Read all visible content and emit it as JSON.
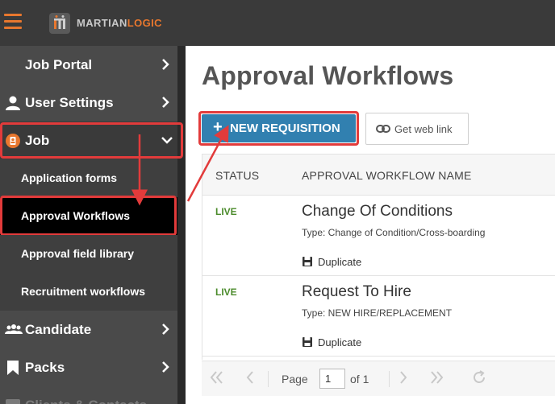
{
  "header": {
    "logo_part1": "MARTIAN",
    "logo_part2": "LOGIC",
    "brand_color": "#e8772e"
  },
  "sidebar": {
    "items": [
      {
        "label": "Job Portal",
        "icon": "none"
      },
      {
        "label": "User Settings",
        "icon": "user-icon"
      },
      {
        "label": "Job",
        "icon": "job-icon",
        "expanded": true
      },
      {
        "label": "Candidate",
        "icon": "users-icon"
      },
      {
        "label": "Packs",
        "icon": "bookmark-icon"
      },
      {
        "label": "Clients & Contacts",
        "icon": "contacts-icon"
      }
    ],
    "job_subitems": [
      {
        "label": "Application forms"
      },
      {
        "label": "Approval Workflows",
        "active": true
      },
      {
        "label": "Approval field library"
      },
      {
        "label": "Recruitment workflows"
      }
    ]
  },
  "main": {
    "title": "Approval Workflows",
    "new_button": "NEW REQUISITION",
    "new_button_icon": "+",
    "web_link_button": "Get web link",
    "table": {
      "headers": [
        "STATUS",
        "APPROVAL WORKFLOW NAME"
      ],
      "rows": [
        {
          "status": "LIVE",
          "name": "Change Of Conditions",
          "type": "Type: Change of Condition/Cross-boarding",
          "action": "Duplicate"
        },
        {
          "status": "LIVE",
          "name": "Request To Hire",
          "type": "Type: NEW HIRE/REPLACEMENT",
          "action": "Duplicate"
        }
      ]
    },
    "pager": {
      "page_label": "Page",
      "page_value": "1",
      "of_label": "of 1"
    }
  },
  "colors": {
    "accent_blue": "#3180b0",
    "status_live": "#4b8b2b",
    "highlight_red": "#e23b3b"
  }
}
